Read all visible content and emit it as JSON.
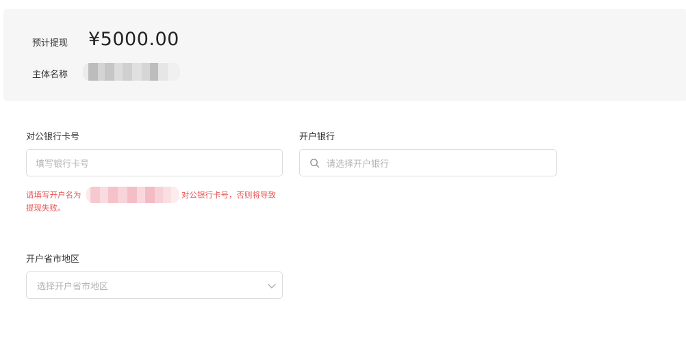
{
  "summary": {
    "estimate_label": "预计提现",
    "amount": "¥5000.00",
    "entity_label": "主体名称"
  },
  "card_number": {
    "label": "对公银行卡号",
    "placeholder": "填写银行卡号"
  },
  "bank": {
    "label": "开户银行",
    "placeholder": "请选择开户银行"
  },
  "hint": {
    "prefix": "请填写开户名为",
    "suffix": "对公银行卡号，否则将导致",
    "line2": "提现失败。"
  },
  "region": {
    "label": "开户省市地区",
    "placeholder": "选择开户省市地区"
  },
  "colors": {
    "panel_bg": "#f6f6f6",
    "error_text": "#e85454",
    "border": "#dcdcdc",
    "placeholder": "#b4b4b4"
  },
  "icons": [
    "search-icon",
    "chevron-down-icon"
  ]
}
